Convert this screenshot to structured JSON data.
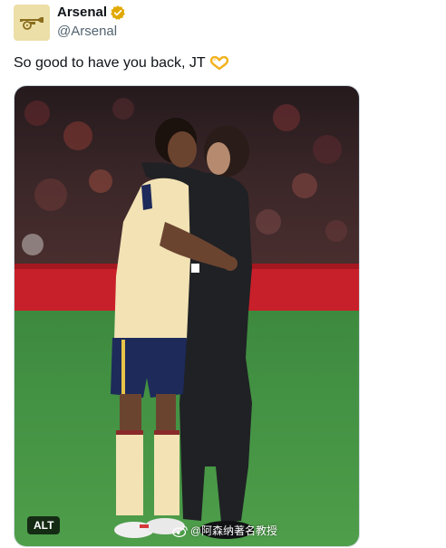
{
  "tweet": {
    "author": {
      "display_name": "Arsenal",
      "handle": "@Arsenal",
      "verified": true,
      "avatar_icon": "arsenal-cannon-icon",
      "avatar_color": "#ecdfa7"
    },
    "text": "So good to have you back, JT",
    "text_emoji": "heart-hands-icon",
    "media": {
      "alt_label": "ALT",
      "watermark": "@阿森纳著名教授",
      "watermark_icon": "weibo-icon"
    }
  },
  "colors": {
    "verified_badge": "#e0a800",
    "handle_text": "#536471",
    "pitch_green": "#3e8a3f",
    "ad_board_red": "#c8202a"
  }
}
